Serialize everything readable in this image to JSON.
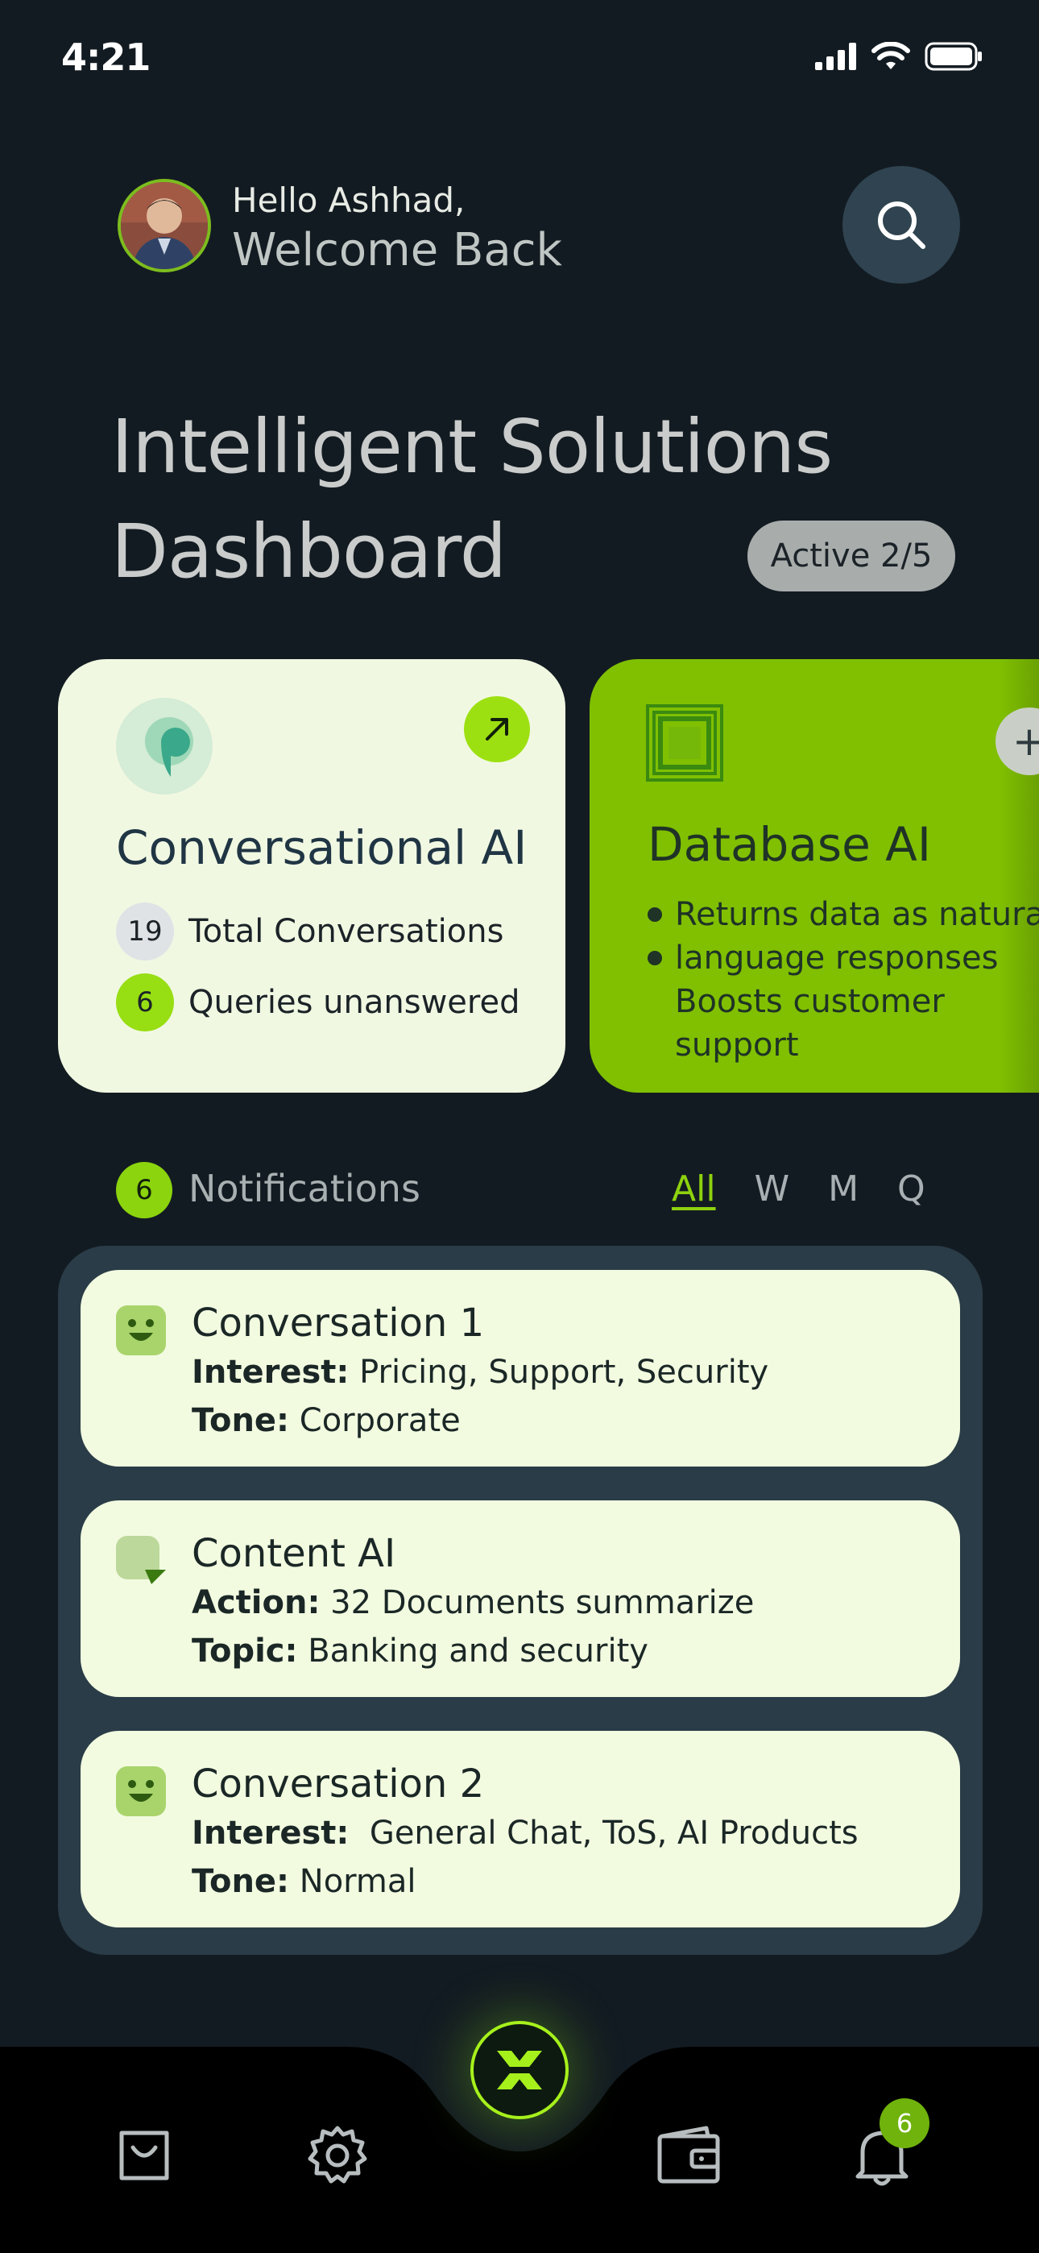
{
  "status_bar": {
    "time": "4:21"
  },
  "header": {
    "greeting": "Hello Ashhad,",
    "welcome": "Welcome Back"
  },
  "hero": {
    "title_line1": "Intelligent Solutions",
    "title_line2": "Dashboard",
    "active_pill": "Active 2/5"
  },
  "cards": {
    "conversational": {
      "title": "Conversational AI",
      "stats": [
        {
          "value": "19",
          "label": "Total Conversations"
        },
        {
          "value": "6",
          "label": "Queries unanswered"
        }
      ]
    },
    "database": {
      "title": "Database AI",
      "bullets": [
        "Returns data as natural",
        "language responses",
        "Boosts customer",
        "support"
      ]
    }
  },
  "notifications": {
    "count": "6",
    "label": "Notifications",
    "filters": [
      "All",
      "W",
      "M",
      "Q"
    ],
    "active_filter": "All",
    "items": [
      {
        "title": "Conversation 1",
        "line1_key": "Interest:",
        "line1_value": " Pricing, Support, Security",
        "line2_key": "Tone:",
        "line2_value": " Corporate",
        "icon": "smiley-icon"
      },
      {
        "title": "Content AI",
        "line1_key": "Action:",
        "line1_value": " 32 Documents summarize",
        "line2_key": "Topic:",
        "line2_value": " Banking and security",
        "icon": "content-icon"
      },
      {
        "title": "Conversation 2",
        "line1_key": "Interest:",
        "line1_value": "  General Chat, ToS, AI Products",
        "line2_key": "Tone:",
        "line2_value": " Normal",
        "icon": "smiley-icon"
      }
    ]
  },
  "bottom_nav": {
    "items": [
      "bag-icon",
      "settings-icon",
      "home-x-icon",
      "wallet-icon",
      "bell-icon"
    ],
    "bell_badge": "6"
  },
  "colors": {
    "background": "#131b22",
    "accent_green": "#8ed20e",
    "card_light": "#f1f8e2",
    "panel": "#2a3c47"
  }
}
